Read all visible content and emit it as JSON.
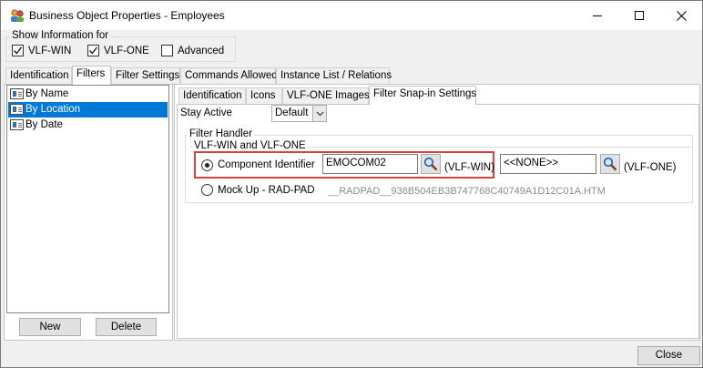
{
  "window": {
    "title": "Business Object Properties - Employees",
    "controls": [
      "minimize-icon",
      "maximize-icon",
      "close-icon"
    ]
  },
  "show_info": {
    "title": "Show Information for",
    "options": [
      {
        "label": "VLF-WIN",
        "checked": true
      },
      {
        "label": "VLF-ONE",
        "checked": true
      },
      {
        "label": "Advanced",
        "checked": false
      }
    ]
  },
  "main_tabs": [
    {
      "label": "Identification",
      "active": false
    },
    {
      "label": "Filters",
      "active": true
    },
    {
      "label": "Filter Settings",
      "active": false
    },
    {
      "label": "Commands Allowed",
      "active": false
    },
    {
      "label": "Instance List / Relations",
      "active": false
    }
  ],
  "filters_list": [
    {
      "label": "By Name",
      "selected": false
    },
    {
      "label": "By Location",
      "selected": true
    },
    {
      "label": "By Date",
      "selected": false
    }
  ],
  "list_buttons": {
    "new": "New",
    "delete": "Delete"
  },
  "sub_tabs": [
    {
      "label": "Identification",
      "active": false
    },
    {
      "label": "Icons",
      "active": false
    },
    {
      "label": "VLF-ONE Images",
      "active": false
    },
    {
      "label": "Filter Snap-in Settings",
      "active": true
    }
  ],
  "stay_active": {
    "label": "Stay Active",
    "value": "Default"
  },
  "filter_handler": {
    "title": "Filter Handler",
    "subgroup_title": "VLF-WIN and VLF-ONE",
    "component_identifier": {
      "label": "Component Identifier",
      "selected": true,
      "win_value": "EMOCOM02",
      "win_suffix": "(VLF-WIN)",
      "one_value": "<<NONE>>",
      "one_suffix": "(VLF-ONE)"
    },
    "mock_up": {
      "label": "Mock Up - RAD-PAD",
      "selected": false,
      "value": "__RADPAD__938B504EB3B747768C40749A1D12C01A.HTM"
    }
  },
  "footer": {
    "close": "Close"
  },
  "colors": {
    "selection": "#0078d7",
    "highlight_border": "#d9403a"
  }
}
